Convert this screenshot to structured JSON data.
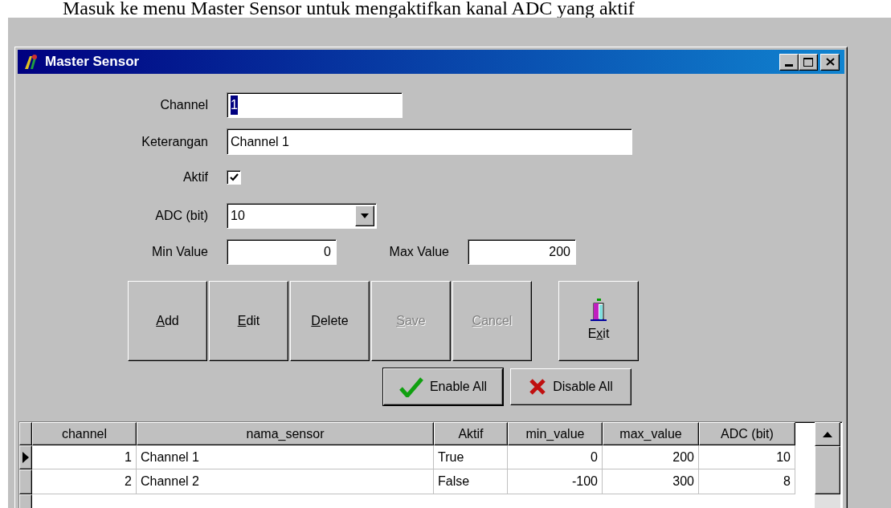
{
  "caption": "Masuk ke menu Master Sensor untuk mengaktifkan kanal ADC yang aktif",
  "window": {
    "title": "Master Sensor"
  },
  "form": {
    "channel": {
      "label": "Channel",
      "value": "1",
      "selected": true
    },
    "keterangan": {
      "label": "Keterangan",
      "value": "Channel 1"
    },
    "aktif": {
      "label": "Aktif",
      "checked": true
    },
    "adc": {
      "label": "ADC (bit)",
      "value": "10"
    },
    "min": {
      "label": "Min Value",
      "value": "0"
    },
    "max": {
      "label": "Max Value",
      "value": "200"
    }
  },
  "buttons": [
    {
      "key": "A",
      "after": "dd",
      "disabled": false
    },
    {
      "key": "E",
      "after": "dit",
      "disabled": false
    },
    {
      "key": "D",
      "after": "elete",
      "disabled": false
    },
    {
      "key": "S",
      "after": "ave",
      "disabled": true
    },
    {
      "key": "C",
      "after": "ancel",
      "disabled": true
    }
  ],
  "exit_button": {
    "before": "E",
    "key": "x",
    "after": "it",
    "disabled": false
  },
  "bulk_buttons": [
    {
      "kind": "enable",
      "label": "Enable All",
      "default": true
    },
    {
      "kind": "disable",
      "label": "Disable All",
      "default": false
    }
  ],
  "grid": {
    "columns": [
      {
        "label": "channel",
        "kind": "number"
      },
      {
        "label": "nama_sensor",
        "kind": "text"
      },
      {
        "label": "Aktif",
        "kind": "text"
      },
      {
        "label": "min_value",
        "kind": "number"
      },
      {
        "label": "max_value",
        "kind": "number"
      },
      {
        "label": "ADC (bit)",
        "kind": "number"
      }
    ],
    "rows": [
      {
        "selected": true,
        "cells": [
          "1",
          "Channel 1",
          "True",
          "0",
          "200",
          "10"
        ]
      },
      {
        "selected": false,
        "cells": [
          "2",
          "Channel 2",
          "False",
          "-100",
          "300",
          "8"
        ]
      }
    ]
  }
}
